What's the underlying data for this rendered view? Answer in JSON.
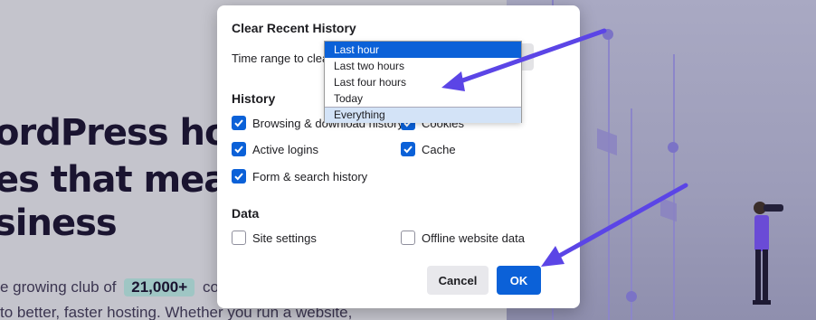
{
  "background": {
    "headline_lines": [
      "ordPress host",
      "es that mean",
      "siness"
    ],
    "body_line1_pre": "e growing club of",
    "body_pill": "21,000+",
    "body_line1_post": "compa",
    "body_line2": "to better, faster hosting. Whether you run a website,"
  },
  "dialog": {
    "title": "Clear Recent History",
    "time_range_label": "Time range to clear:",
    "dropdown_options": [
      {
        "label": "Last hour",
        "state": "selected"
      },
      {
        "label": "Last two hours",
        "state": "normal"
      },
      {
        "label": "Last four hours",
        "state": "normal"
      },
      {
        "label": "Today",
        "state": "normal"
      },
      {
        "label": "Everything",
        "state": "hover"
      }
    ],
    "history_heading": "History",
    "history_items": [
      {
        "label": "Browsing & download history",
        "checked": true
      },
      {
        "label": "Cookies",
        "checked": true
      },
      {
        "label": "Active logins",
        "checked": true
      },
      {
        "label": "Cache",
        "checked": true
      },
      {
        "label": "Form & search history",
        "checked": true
      }
    ],
    "data_heading": "Data",
    "data_items": [
      {
        "label": "Site settings",
        "checked": false
      },
      {
        "label": "Offline website data",
        "checked": false
      }
    ],
    "cancel_label": "Cancel",
    "ok_label": "OK"
  },
  "colors": {
    "accent": "#0b61d8",
    "annotation_arrow": "#5b45e6"
  },
  "icons": {
    "checked": "checkmark-icon",
    "annotation": "arrow-icon"
  }
}
